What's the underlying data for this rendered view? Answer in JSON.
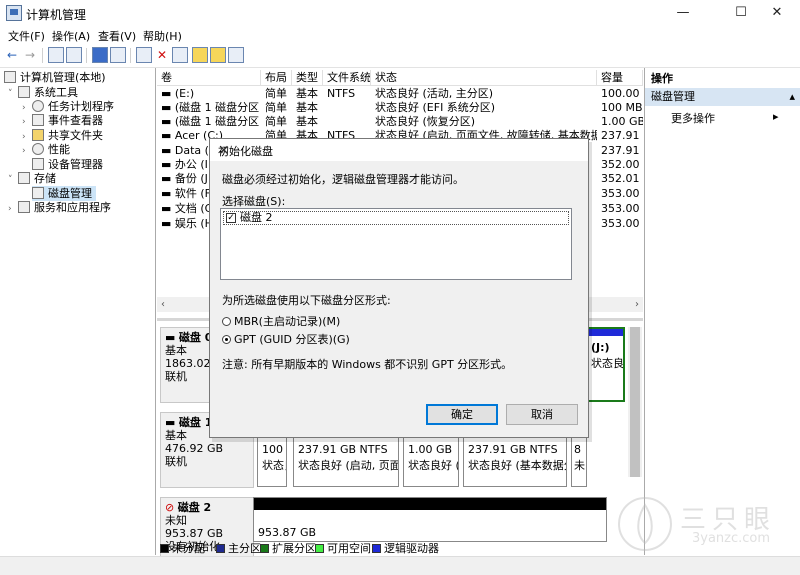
{
  "window": {
    "title": "计算机管理",
    "min": "—",
    "max": "☐",
    "close": "✕"
  },
  "menu": [
    "文件(F)",
    "操作(A)",
    "查看(V)",
    "帮助(H)"
  ],
  "toolbar": {
    "back": "←",
    "forward": "→",
    "delete": "✕"
  },
  "tree": {
    "root": "计算机管理(本地)",
    "system_tools": "系统工具",
    "task_scheduler": "任务计划程序",
    "event_viewer": "事件查看器",
    "shared_folders": "共享文件夹",
    "performance": "性能",
    "device_manager": "设备管理器",
    "storage": "存储",
    "disk_management": "磁盘管理",
    "services_apps": "服务和应用程序"
  },
  "volume_table": {
    "headers": [
      "卷",
      "布局",
      "类型",
      "文件系统",
      "状态",
      "容量"
    ],
    "rows": [
      [
        "(E:)",
        "简单",
        "基本",
        "NTFS",
        "状态良好 (活动, 主分区)",
        "100.00 G"
      ],
      [
        "(磁盘 1 磁盘分区 1)",
        "简单",
        "基本",
        "",
        "状态良好 (EFI 系统分区)",
        "100 MB"
      ],
      [
        "(磁盘 1 磁盘分区 4)",
        "简单",
        "基本",
        "",
        "状态良好 (恢复分区)",
        "1.00 GB"
      ],
      [
        "Acer (C:)",
        "简单",
        "基本",
        "NTFS",
        "状态良好 (启动, 页面文件, 故障转储, 基本数据分区)",
        "237.91 G"
      ],
      [
        "Data (D:)",
        "",
        "",
        "",
        "",
        "237.91 G"
      ],
      [
        "办公 (I:)",
        "",
        "",
        "",
        "",
        "352.00 G"
      ],
      [
        "备份 (J:)",
        "",
        "",
        "",
        "",
        "352.01 G"
      ],
      [
        "软件 (F:)",
        "",
        "",
        "",
        "",
        "353.00 G"
      ],
      [
        "文档 (G:)",
        "",
        "",
        "",
        "",
        "353.00 G"
      ],
      [
        "娱乐 (H:)",
        "",
        "",
        "",
        "",
        "353.00 G"
      ]
    ],
    "scroll_left": "‹",
    "scroll_right": "›"
  },
  "disks": {
    "disk0": {
      "name": "磁盘 0",
      "type": "基本",
      "size": "1863.02 GB",
      "state": "联机",
      "right_part": "(J:)",
      "right_part_status": "状态良好 (基"
    },
    "disk1": {
      "name": "磁盘 1",
      "type": "基本",
      "size": "476.92 GB",
      "state": "联机",
      "parts": [
        {
          "size": "100 M",
          "status": "状态良"
        },
        {
          "size": "237.91 GB NTFS",
          "status": "状态良好 (启动, 页面文"
        },
        {
          "size": "1.00 GB",
          "status": "状态良好 ("
        },
        {
          "size": "237.91 GB NTFS",
          "status": "状态良好 (基本数据分"
        },
        {
          "size": "8",
          "status": "未"
        }
      ]
    },
    "disk2": {
      "name": "磁盘 2",
      "type": "未知",
      "size": "953.87 GB",
      "state": "没有初始化",
      "unalloc_size": "953.87 GB"
    }
  },
  "legend": [
    "未分配",
    "主分区",
    "扩展分区",
    "可用空间",
    "逻辑驱动器"
  ],
  "legend_colors": [
    "#000000",
    "#1f2a8f",
    "#1a7a1a",
    "#44ee44",
    "#1f2ad8"
  ],
  "actions": {
    "header": "操作",
    "sub": "磁盘管理",
    "more": "更多操作"
  },
  "dialog": {
    "title": "初始化磁盘",
    "close": "✕",
    "message": "磁盘必须经过初始化，逻辑磁盘管理器才能访问。",
    "select_label": "选择磁盘(S):",
    "disk_item": "磁盘 2",
    "style_label": "为所选磁盘使用以下磁盘分区形式:",
    "mbr": "MBR(主启动记录)(M)",
    "gpt": "GPT (GUID 分区表)(G)",
    "note": "注意: 所有早期版本的 Windows 都不识别 GPT 分区形式。",
    "ok": "确定",
    "cancel": "取消"
  },
  "watermark": {
    "cn": "三只眼",
    "en": "3yanzc.com"
  }
}
